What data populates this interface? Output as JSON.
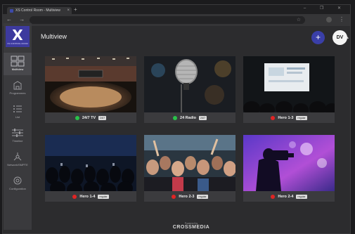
{
  "browser": {
    "tab_title": "XS Control Room - Multiview",
    "tab_close": "×",
    "new_tab": "+",
    "window_controls": "– ❐ ✕",
    "nav": "← → C",
    "menu": "⋮"
  },
  "sidebar": {
    "logo": "X",
    "logo_sub": "XS CONTROL ROOM",
    "items": [
      {
        "label": "Multiview",
        "icon": "grid-icon",
        "active": true
      },
      {
        "label": "Programmes",
        "icon": "building-icon",
        "active": false
      },
      {
        "label": "List",
        "icon": "list-icon",
        "active": false
      },
      {
        "label": "Timeline",
        "icon": "timeline-icon",
        "active": false
      },
      {
        "label": "Network/SMPTE",
        "icon": "network-icon",
        "active": false
      },
      {
        "label": "Configuration",
        "icon": "settings-icon",
        "active": false
      }
    ]
  },
  "header": {
    "title": "Multiview",
    "add_label": "+",
    "avatar_initials": "DV",
    "avatar_caret": "▲"
  },
  "cards": [
    {
      "name": "24/7 TV",
      "badge": "24/7",
      "status": "live",
      "status_color": "#29c24a",
      "scene": "arena"
    },
    {
      "name": "24 Radio",
      "badge": "24/7",
      "status": "live",
      "status_color": "#29c24a",
      "scene": "microphone"
    },
    {
      "name": "Hero 1-3",
      "badge": "regular",
      "status": "offline",
      "status_color": "#e02424",
      "scene": "presentation"
    },
    {
      "name": "Hero 1-4",
      "badge": "regular",
      "status": "offline",
      "status_color": "#e02424",
      "scene": "audience"
    },
    {
      "name": "Hero 2-3",
      "badge": "regular",
      "status": "offline",
      "status_color": "#e02424",
      "scene": "crowd"
    },
    {
      "name": "Hero 2-4",
      "badge": "regular",
      "status": "offline",
      "status_color": "#e02424",
      "scene": "camera"
    }
  ],
  "footer": {
    "powered_by": "Powered by",
    "brand": "CROSSMEDIA"
  },
  "colors": {
    "accent": "#3d3a9e",
    "live": "#29c24a",
    "offline": "#e02424",
    "background": "#2c2c2e"
  }
}
